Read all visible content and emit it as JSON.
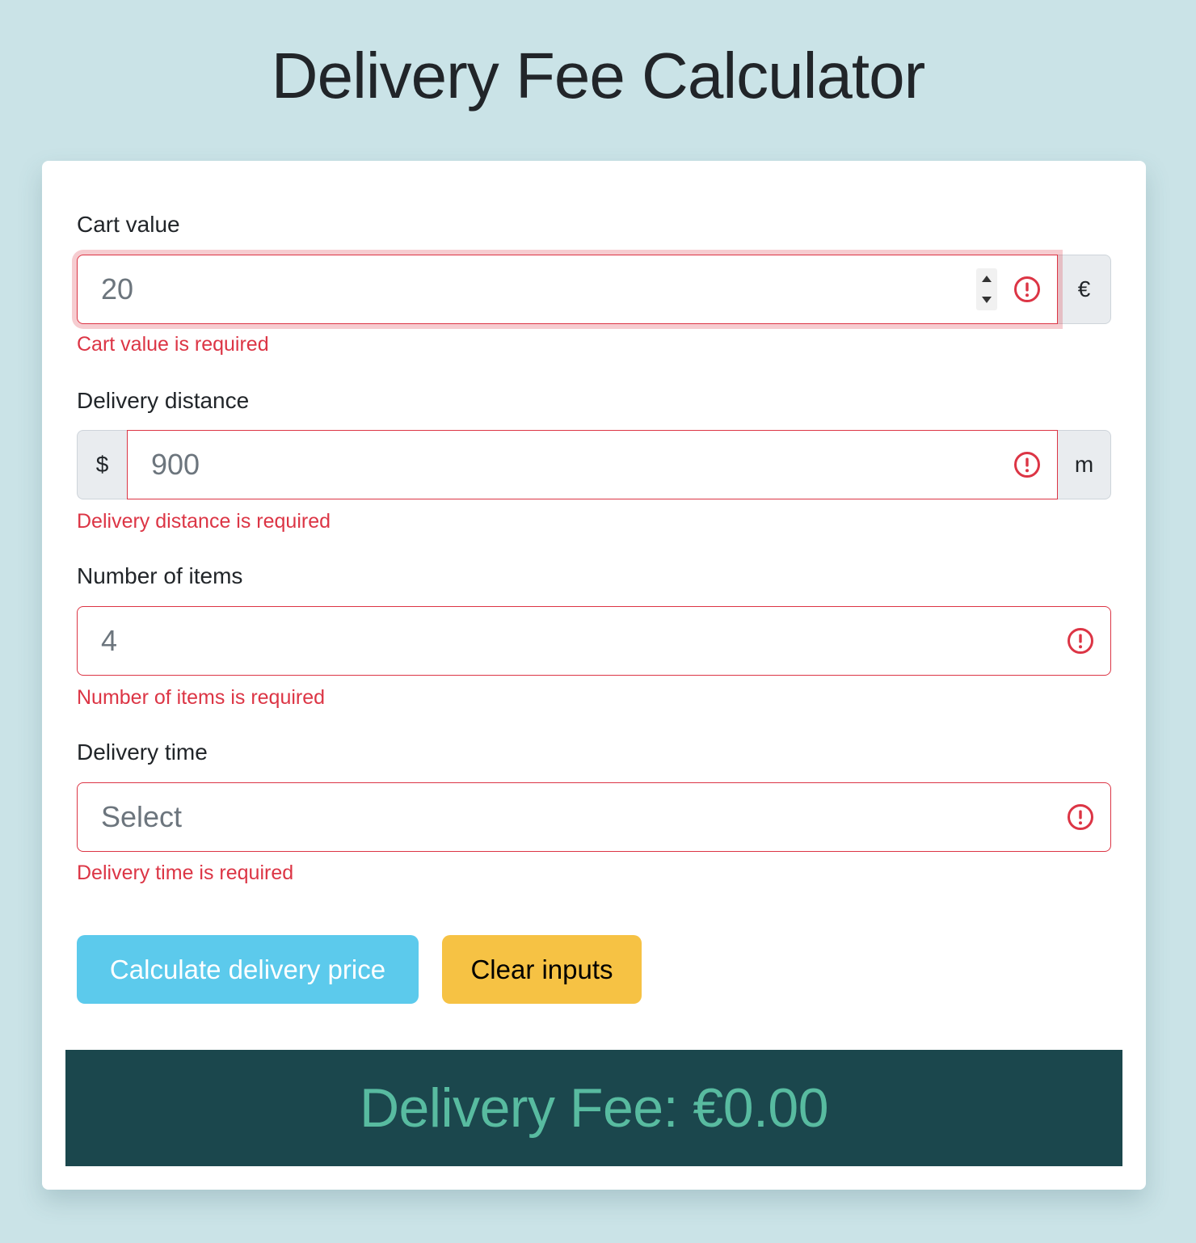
{
  "page": {
    "title": "Delivery Fee Calculator"
  },
  "form": {
    "cart_value": {
      "label": "Cart value",
      "value": "20",
      "suffix": "€",
      "error": "Cart value is required"
    },
    "delivery_distance": {
      "label": "Delivery distance",
      "prefix": "$",
      "value": "900",
      "suffix": "m",
      "error": "Delivery distance is required"
    },
    "number_of_items": {
      "label": "Number of items",
      "value": "4",
      "error": "Number of items is required"
    },
    "delivery_time": {
      "label": "Delivery time",
      "placeholder": "Select",
      "error": "Delivery time is required"
    }
  },
  "buttons": {
    "calculate_label": "Calculate delivery price",
    "clear_label": "Clear inputs"
  },
  "result": {
    "text": "Delivery Fee: €0.00"
  },
  "icons": {
    "validation": "alert-circle-icon",
    "spinner_up": "caret-up-icon",
    "spinner_down": "caret-down-icon"
  },
  "colors": {
    "background": "#cae3e7",
    "error": "#dc3545",
    "calculate_button": "#5ccaec",
    "clear_button": "#f6c244",
    "result_background": "#1b474d",
    "result_text": "#58bba0"
  }
}
